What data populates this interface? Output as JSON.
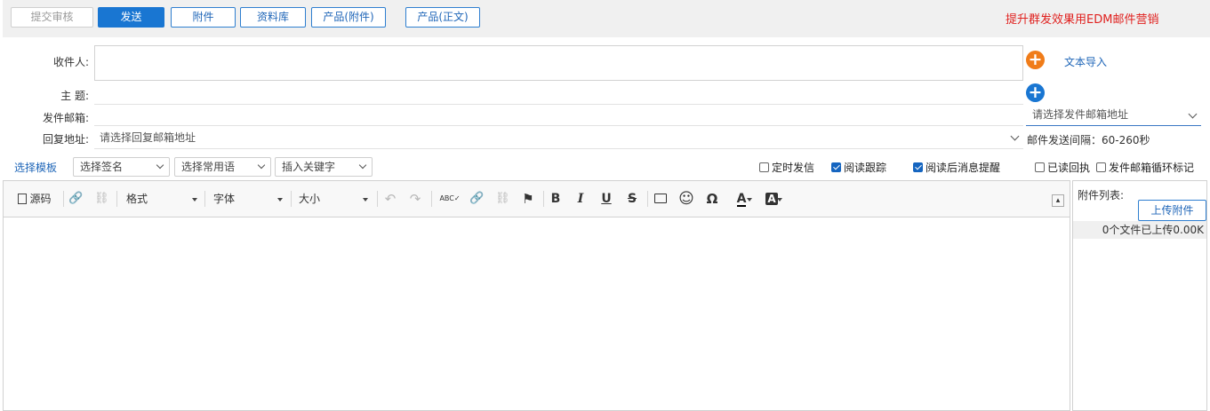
{
  "toolbar": {
    "submit_review": "提交审核",
    "send": "发送",
    "attachment": "附件",
    "library": "资料库",
    "product_attachment": "产品(附件)",
    "product_body": "产品(正文)",
    "promo": "提升群发效果用EDM邮件营销",
    "colors": {
      "primary": "#1976d2",
      "promo": "#e0211f"
    }
  },
  "form": {
    "recipient_label": "收件人:",
    "recipient_value": "",
    "text_import": "文本导入",
    "subject_label": "主 题:",
    "subject_value": "",
    "sender_label": "发件邮箱:",
    "sender_placeholder": "请选择发件邮箱地址",
    "reply_label": "回复地址:",
    "reply_placeholder": "请选择回复邮箱地址",
    "interval": "邮件发送间隔：60-260秒",
    "icons": {
      "add_orange": "plus-circle-orange",
      "add_blue": "plus-circle-blue"
    },
    "colors": {
      "orange": "#f07c19",
      "blue": "#1976d2"
    }
  },
  "options": {
    "template_link": "选择模板",
    "signature": "选择签名",
    "phrases": "选择常用语",
    "keyword": "插入关键字",
    "scheduled": {
      "label": "定时发信",
      "checked": false
    },
    "read_tracking": {
      "label": "阅读跟踪",
      "checked": true
    },
    "read_notify": {
      "label": "阅读后消息提醒",
      "checked": true
    },
    "read_receipt": {
      "label": "已读回执",
      "checked": false
    },
    "loop_mark": {
      "label": "发件邮箱循环标记",
      "checked": false
    }
  },
  "editor": {
    "source": "源码",
    "format": "格式",
    "font": "字体",
    "size": "大小",
    "glyphs": {
      "link": "🔗",
      "undo": "↶",
      "redo": "↷",
      "spell": "ABC✓",
      "flag": "⚑",
      "bold": "B",
      "italic": "I",
      "underline": "U",
      "strike": "S",
      "image": "🖼",
      "smiley": "☺",
      "omega": "Ω",
      "text_color": "A",
      "bg_color": "A",
      "maximize": "▴",
      "unlink": "⛓"
    },
    "body": ""
  },
  "attachments": {
    "title": "附件列表:",
    "upload": "上传附件",
    "status": "0个文件已上传0.00K"
  }
}
